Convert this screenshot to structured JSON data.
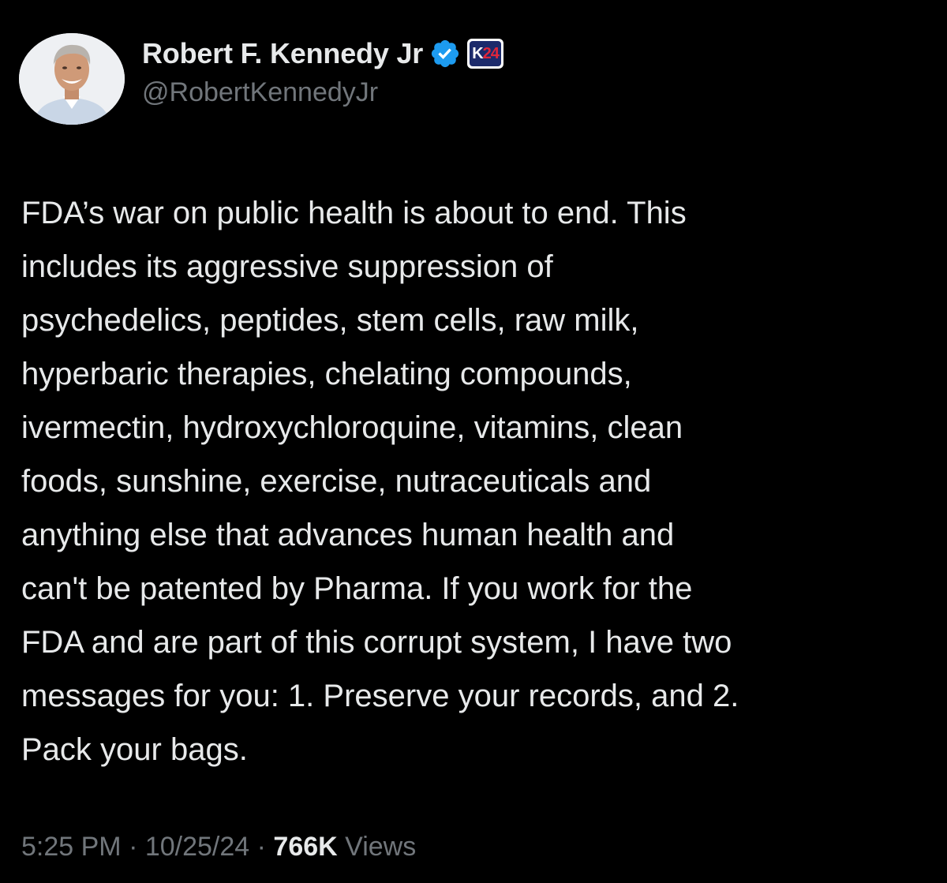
{
  "author": {
    "display_name": "Robert F. Kennedy Jr",
    "handle": "@RobertKennedyJr",
    "verified": true,
    "affiliate_badge": {
      "text_part1": "K",
      "text_part2": "24",
      "background": "#1c2a6b",
      "accent": "#e0263a"
    }
  },
  "tweet": {
    "lines": [
      "FDA’s war on public health is about to end. This",
      "includes its aggressive suppression of",
      "psychedelics, peptides, stem cells, raw milk,",
      "hyperbaric therapies, chelating compounds,",
      "ivermectin, hydroxychloroquine, vitamins, clean",
      "foods, sunshine, exercise, nutraceuticals and",
      "anything else that advances human health and",
      "can't be patented by Pharma. If you work for the",
      "FDA and are part of this corrupt system, I have two",
      "messages for you: 1. Preserve your records, and 2.",
      "Pack your bags."
    ]
  },
  "meta": {
    "time": "5:25 PM",
    "separator": " · ",
    "date": "10/25/24",
    "views_count": "766K",
    "views_label": " Views"
  },
  "colors": {
    "background": "#000000",
    "text_primary": "#e7e9ea",
    "text_secondary": "#71767b",
    "verified_blue": "#1d9bf0"
  }
}
